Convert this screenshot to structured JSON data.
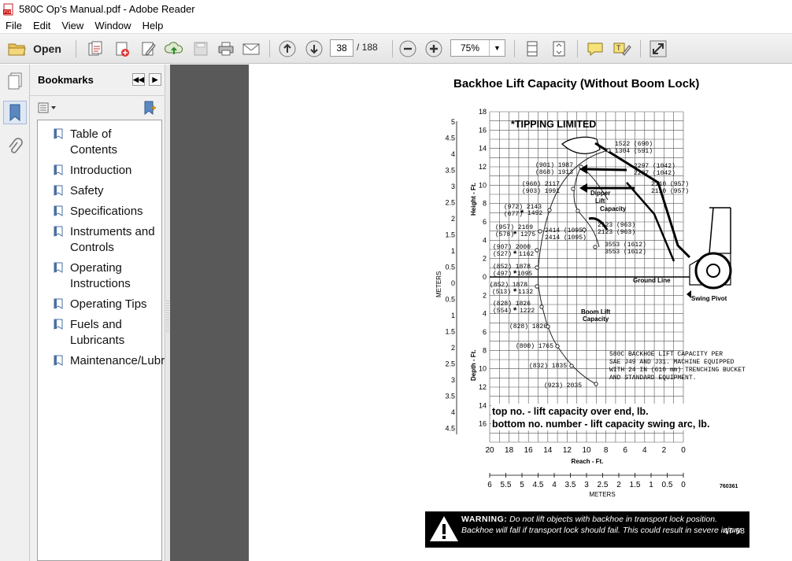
{
  "window": {
    "title": "580C Op's Manual.pdf - Adobe Reader"
  },
  "menu": [
    "File",
    "Edit",
    "View",
    "Window",
    "Help"
  ],
  "toolbar": {
    "open_label": "Open",
    "current_page": "38",
    "total_pages": "/ 188",
    "zoom": "75%"
  },
  "bookmarks": {
    "title": "Bookmarks",
    "items": [
      {
        "label": "Table of Contents"
      },
      {
        "label": "Introduction"
      },
      {
        "label": "Safety"
      },
      {
        "label": "Specifications"
      },
      {
        "label": "Instruments and Controls"
      },
      {
        "label": "Operating Instructions"
      },
      {
        "label": "Operating Tips"
      },
      {
        "label": "Fuels and Lubricants"
      },
      {
        "label": "Maintenance/Lubrication"
      }
    ]
  },
  "document": {
    "title": "Backhoe Lift Capacity (Without Boom Lock)",
    "tipping_note": "*TIPPING LIMITED",
    "y_ft_ticks": [
      "18",
      "16",
      "14",
      "12",
      "10",
      "8",
      "6",
      "4",
      "2",
      "0",
      "2",
      "4",
      "6",
      "8",
      "10",
      "12",
      "14",
      "16"
    ],
    "y_m_ticks": [
      "5",
      "4.5",
      "4",
      "3.5",
      "3",
      "2.5",
      "2",
      "1.5",
      "1",
      "0.5",
      "0",
      "0.5",
      "1",
      "1.5",
      "2",
      "2.5",
      "3",
      "3.5",
      "4",
      "4.5"
    ],
    "x_ft_ticks": [
      "20",
      "18",
      "16",
      "14",
      "12",
      "10",
      "8",
      "6",
      "4",
      "2",
      "0"
    ],
    "x_m_ticks": [
      "6",
      "5.5",
      "5",
      "4.5",
      "4",
      "3.5",
      "3",
      "2.5",
      "2",
      "1.5",
      "1",
      "0.5",
      "0"
    ],
    "height_label": "Height - Ft.",
    "depth_label": "Depth - Ft.",
    "meters_label": "METERS",
    "reach_label": "Reach - Ft.",
    "reach_meters_label": "METERS",
    "dipper_label": [
      "Dipper",
      "Lift",
      "Capacity"
    ],
    "boom_label": [
      "Boom Lift",
      "Capacity"
    ],
    "ground_line": "Ground Line",
    "swing_pivot": "Swing Pivot",
    "machine_note": [
      "580C BACKHOE LIFT CAPACITY PER",
      "SAE J49 AND J31. MACHINE EQUIPPED",
      "WITH 24 IN (610 mm) TRENCHING BUCKET",
      "AND STANDARD EQUIPMENT."
    ],
    "legend_top": "top no. - lift capacity over end, lb.",
    "legend_bottom": "bottom no. number - lift capacity swing arc, lb.",
    "figure_id": "760361",
    "warning_title": "WARNING:",
    "warning_text": "Do not lift objects with backhoe in transport lock position. Backhoe will fall if transport lock should fail. This could result in severe injury.",
    "page_ref": "47-68",
    "capacity_labels": [
      {
        "t": "1522  (690)"
      },
      {
        "t": "1304  (591)"
      },
      {
        "t": "(901)  1987"
      },
      {
        "t": "(868)  1913"
      },
      {
        "t": "2297  (1042)"
      },
      {
        "t": "2297  (1042)"
      },
      {
        "t": "(960)  2117"
      },
      {
        "t": "(903)  1991"
      },
      {
        "t": "2110   (957)"
      },
      {
        "t": "2110   (957)"
      },
      {
        "t": "(972)    2143"
      },
      {
        "t": "(677)"
      },
      {
        "t": "1492"
      },
      {
        "t": "2123  (963)"
      },
      {
        "t": "2123  (963)"
      },
      {
        "t": "(957)     2109"
      },
      {
        "t": "(578)"
      },
      {
        "t": "1275"
      },
      {
        "t": "2414 (1095)"
      },
      {
        "t": "2414 (1095)"
      },
      {
        "t": "3553  (1612)"
      },
      {
        "t": "3553  (1612)"
      },
      {
        "t": "(907)     2000"
      },
      {
        "t": "(527)"
      },
      {
        "t": "1162"
      },
      {
        "t": "(852)     1878"
      },
      {
        "t": "(497)"
      },
      {
        "t": "1095"
      },
      {
        "t": "(852)     1878"
      },
      {
        "t": "(513)"
      },
      {
        "t": "1132"
      },
      {
        "t": "(828)     1826"
      },
      {
        "t": "(554)"
      },
      {
        "t": "1222"
      },
      {
        "t": "(828)  1826"
      },
      {
        "t": "(800)  1765"
      },
      {
        "t": "(832)  1835"
      },
      {
        "t": "(923) 2035"
      }
    ]
  }
}
